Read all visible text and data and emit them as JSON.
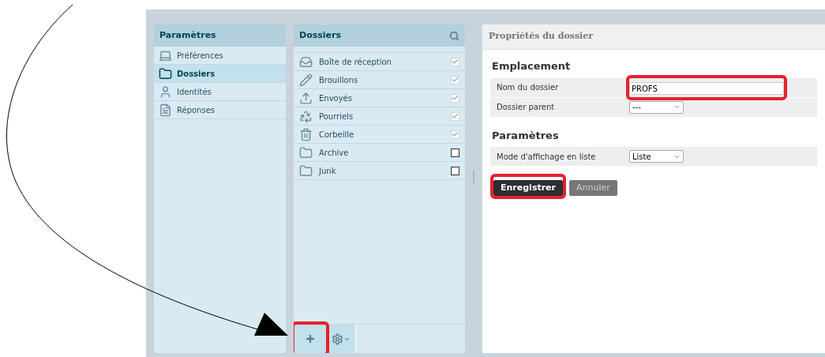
{
  "settings_panel": {
    "title": "Paramètres",
    "items": [
      {
        "label": "Préférences",
        "kind": "laptop",
        "selected": false
      },
      {
        "label": "Dossiers",
        "kind": "folder",
        "selected": true
      },
      {
        "label": "Identités",
        "kind": "person",
        "selected": false
      },
      {
        "label": "Réponses",
        "kind": "document",
        "selected": false
      }
    ]
  },
  "folders_panel": {
    "title": "Dossiers",
    "folders": [
      {
        "label": "Boîte de réception",
        "kind": "inbox",
        "checked": true,
        "disabled": true
      },
      {
        "label": "Brouillons",
        "kind": "pencil",
        "checked": true,
        "disabled": true
      },
      {
        "label": "Envoyés",
        "kind": "outbox",
        "checked": true,
        "disabled": true
      },
      {
        "label": "Pourriels",
        "kind": "junk",
        "checked": true,
        "disabled": true
      },
      {
        "label": "Corbeille",
        "kind": "trash",
        "checked": true,
        "disabled": true
      },
      {
        "label": "Archive",
        "kind": "folder",
        "checked": false,
        "disabled": false
      },
      {
        "label": "Junk",
        "kind": "folder",
        "checked": false,
        "disabled": false
      }
    ]
  },
  "properties": {
    "title": "Propriétés du dossier",
    "sections": [
      {
        "heading": "Emplacement",
        "rows": [
          {
            "label": "Nom du dossier",
            "kind": "text",
            "value": "PROFS",
            "highlighted": true
          },
          {
            "label": "Dossier parent",
            "kind": "select",
            "value": "---",
            "highlighted": false
          }
        ]
      },
      {
        "heading": "Paramètres",
        "rows": [
          {
            "label": "Mode d'affichage en liste",
            "kind": "select",
            "value": "Liste",
            "highlighted": false
          }
        ]
      }
    ],
    "buttons": [
      {
        "label": "Enregistrer",
        "kind": "primary",
        "highlighted": true
      },
      {
        "label": "Annuler",
        "kind": "secondary",
        "highlighted": false
      }
    ]
  }
}
